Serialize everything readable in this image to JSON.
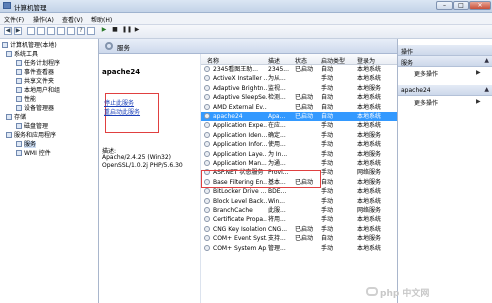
{
  "window": {
    "title": "计算机管理"
  },
  "menu": [
    "文件(F)",
    "操作(A)",
    "查看(V)",
    "帮助(H)"
  ],
  "tree": [
    {
      "label": "计算机管理(本地)",
      "indent": 0
    },
    {
      "label": "系统工具",
      "indent": 1
    },
    {
      "label": "任务计划程序",
      "indent": 2
    },
    {
      "label": "事件查看器",
      "indent": 2
    },
    {
      "label": "共享文件夹",
      "indent": 2
    },
    {
      "label": "本地用户和组",
      "indent": 2
    },
    {
      "label": "性能",
      "indent": 2
    },
    {
      "label": "设备管理器",
      "indent": 2
    },
    {
      "label": "存储",
      "indent": 1
    },
    {
      "label": "磁盘管理",
      "indent": 2
    },
    {
      "label": "服务和应用程序",
      "indent": 1
    },
    {
      "label": "服务",
      "indent": 2,
      "selected": true
    },
    {
      "label": "WMI 控件",
      "indent": 2
    }
  ],
  "center": {
    "header": "服务",
    "service_name": "apache24",
    "stop_link": "停止此服务",
    "restart_link": "重启动此服务",
    "desc_label": "描述:",
    "desc_text": "Apache/2.4.25 (Win32) OpenSSL/1.0.2j PHP/5.6.30"
  },
  "columns": [
    "名称",
    "描述",
    "状态",
    "启动类型",
    "登录为"
  ],
  "services": [
    [
      "2345看图王助...",
      "2345...",
      "已启动",
      "自动",
      "本地系统"
    ],
    [
      "ActiveX Installer ...",
      "为从...",
      "",
      "手动",
      "本地系统"
    ],
    [
      "Adaptive Brightn...",
      "监视...",
      "",
      "手动",
      "本地服务"
    ],
    [
      "Adaptive SleepSe...",
      "检测...",
      "已启动",
      "自动",
      "本地系统"
    ],
    [
      "AMD External Ev...",
      "",
      "已启动",
      "自动",
      "本地系统"
    ],
    [
      "apache24",
      "Apa...",
      "已启动",
      "自动",
      "本地系统"
    ],
    [
      "Application Expe...",
      "在应...",
      "",
      "手动",
      "本地系统"
    ],
    [
      "Application Iden...",
      "确定...",
      "",
      "手动",
      "本地服务"
    ],
    [
      "Application Infor...",
      "使用...",
      "",
      "手动",
      "本地系统"
    ],
    [
      "Application Laye...",
      "为 In...",
      "",
      "手动",
      "本地服务"
    ],
    [
      "Application Man...",
      "为通...",
      "",
      "手动",
      "本地系统"
    ],
    [
      "ASP.NET 状态服务",
      "Provi...",
      "",
      "手动",
      "网络服务"
    ],
    [
      "Base Filtering En...",
      "基本...",
      "已启动",
      "自动",
      "本地服务"
    ],
    [
      "BitLocker Drive ...",
      "BDE...",
      "",
      "手动",
      "本地系统"
    ],
    [
      "Block Level Back...",
      "Win...",
      "",
      "手动",
      "本地系统"
    ],
    [
      "BranchCache",
      "此服...",
      "",
      "手动",
      "网络服务"
    ],
    [
      "Certificate Propa...",
      "将用...",
      "",
      "手动",
      "本地系统"
    ],
    [
      "CNG Key Isolation",
      "CNG...",
      "已启动",
      "手动",
      "本地系统"
    ],
    [
      "COM+ Event Syst...",
      "支持...",
      "已启动",
      "自动",
      "本地服务"
    ],
    [
      "COM+ System Ap...",
      "管理...",
      "",
      "手动",
      "本地系统"
    ]
  ],
  "selected_service_index": 5,
  "actions": {
    "section1": "服务",
    "more1": "更多操作",
    "section2": "apache24",
    "more2": "更多操作"
  },
  "watermark": "php 中文网"
}
